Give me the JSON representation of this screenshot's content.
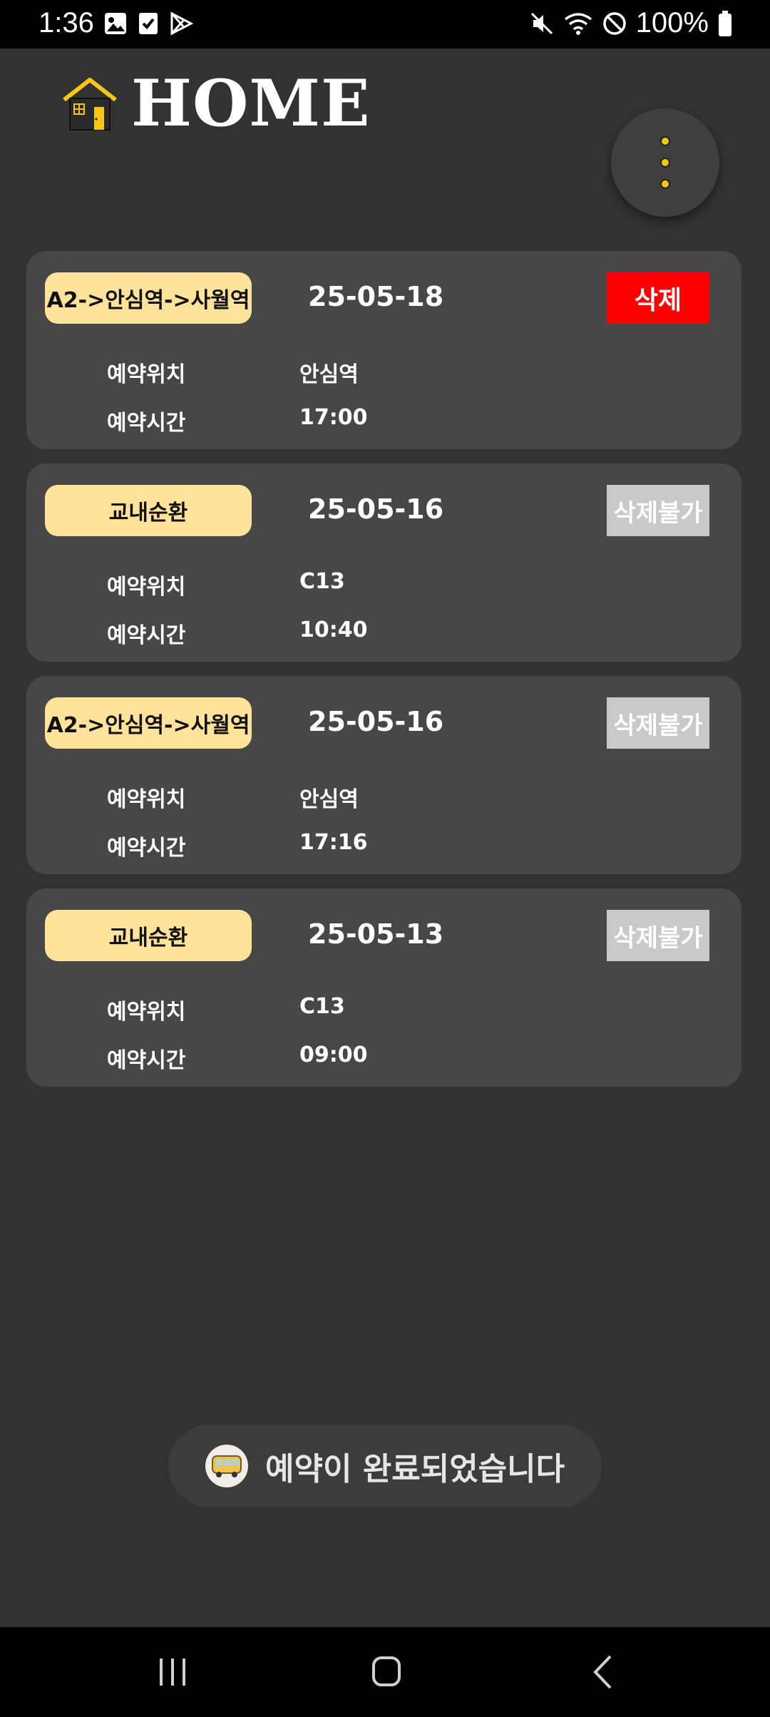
{
  "status_bar": {
    "time": "1:36",
    "battery_percent": "100%",
    "left_icons": [
      "gallery-icon",
      "checkbox-icon",
      "play-store-icon"
    ],
    "right_icons": [
      "mute-icon",
      "wifi-icon",
      "do-not-disturb-icon",
      "battery-icon"
    ]
  },
  "header": {
    "title": "HOME",
    "icon": "house-icon",
    "menu_icon": "more-vertical-icon",
    "accent_color": "#f5c518"
  },
  "reservations": [
    {
      "route": "A2->안심역->사월역",
      "date": "25-05-18",
      "delete_label": "삭제",
      "delete_enabled": true,
      "location_label": "예약위치",
      "location_value": "안심역",
      "time_label": "예약시간",
      "time_value": "17:00"
    },
    {
      "route": "교내순환",
      "date": "25-05-16",
      "delete_label": "삭제불가",
      "delete_enabled": false,
      "location_label": "예약위치",
      "location_value": "C13",
      "time_label": "예약시간",
      "time_value": "10:40"
    },
    {
      "route": "A2->안심역->사월역",
      "date": "25-05-16",
      "delete_label": "삭제불가",
      "delete_enabled": false,
      "location_label": "예약위치",
      "location_value": "안심역",
      "time_label": "예약시간",
      "time_value": "17:16"
    },
    {
      "route": "교내순환",
      "date": "25-05-13",
      "delete_label": "삭제불가",
      "delete_enabled": false,
      "location_label": "예약위치",
      "location_value": "C13",
      "time_label": "예약시간",
      "time_value": "09:00"
    }
  ],
  "toast": {
    "icon": "bus-icon",
    "message": "예약이 완료되었습니다"
  },
  "nav_bar": {
    "items": [
      "recents-icon",
      "home-icon",
      "back-icon"
    ]
  },
  "colors": {
    "background": "#323232",
    "card": "#474747",
    "route_pill": "#ffe39b",
    "delete_active": "#ff0000",
    "delete_disabled": "#c9c9c9"
  }
}
